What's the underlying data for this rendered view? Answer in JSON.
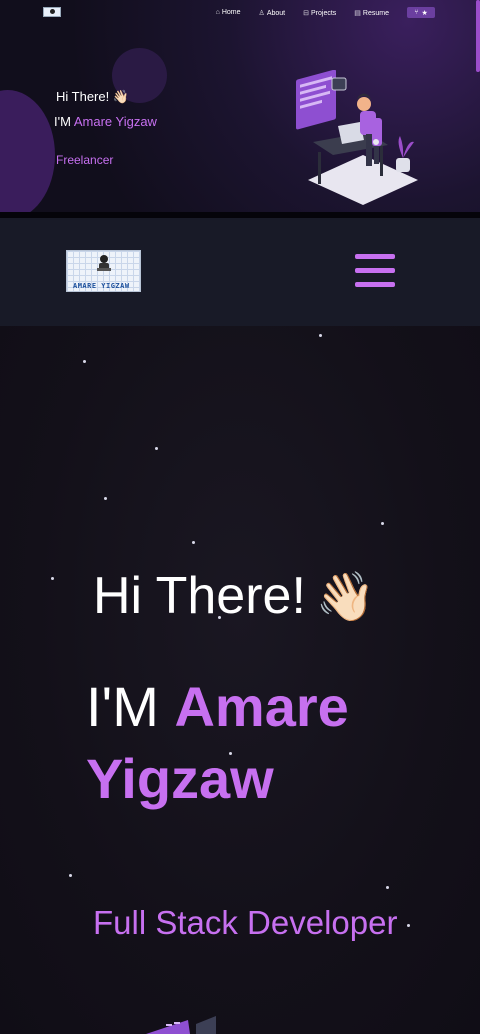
{
  "preview": {
    "nav": [
      {
        "icon": "home-icon",
        "glyph": "⌂",
        "label": "Home"
      },
      {
        "icon": "user-icon",
        "glyph": "♙",
        "label": "About"
      },
      {
        "icon": "projects-icon",
        "glyph": "⊟",
        "label": "Projects"
      },
      {
        "icon": "resume-icon",
        "glyph": "▤",
        "label": "Resume"
      }
    ],
    "star_button": {
      "icon_a": "⑂",
      "icon_b": "★"
    },
    "greeting": "Hi There! 👋🏻",
    "name_prefix": "I'M",
    "name": "Amare Yigzaw",
    "typed_role": "Freelancer"
  },
  "navbar": {
    "logo_text": "AMARE YIGZAW",
    "menu_icon": "hamburger-icon"
  },
  "hero": {
    "greeting": "Hi There!",
    "wave": "👋🏻",
    "name_prefix": "I'M",
    "name_first": "Amare",
    "name_last": "Yigzaw",
    "typed_role": "Full Stack Developer"
  },
  "colors": {
    "accent": "#c770f0",
    "navbar_bg": "#181a27",
    "hero_bg": "#131019"
  }
}
